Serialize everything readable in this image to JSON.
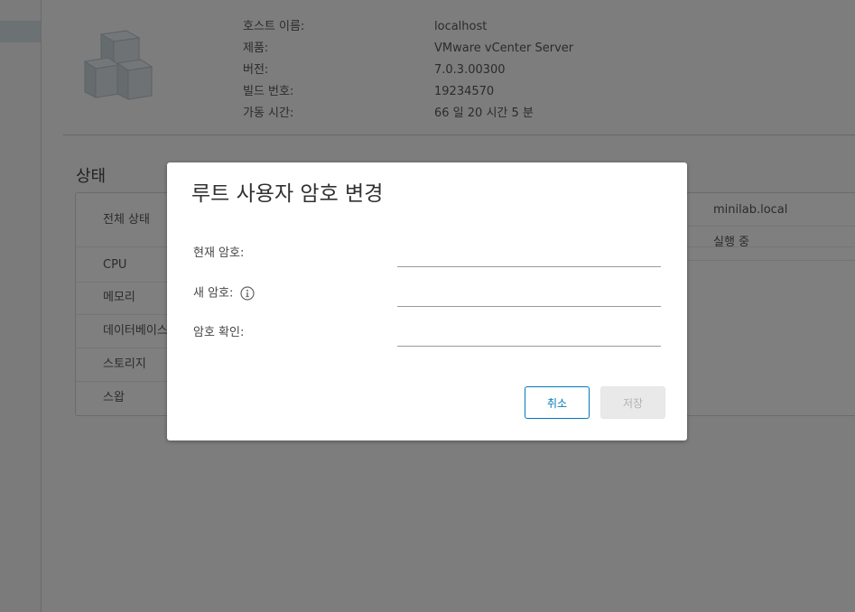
{
  "summary": {
    "labels": [
      "호스트 이름:",
      "제품:",
      "버전:",
      "빌드 번호:",
      "가동 시간:"
    ],
    "values": [
      "localhost",
      "VMware vCenter Server",
      "7.0.3.00300",
      "19234570",
      "66 일 20 시간 5 분"
    ]
  },
  "status": {
    "title": "상태",
    "rows": [
      "전체 상태",
      "CPU",
      "메모리",
      "데이터베이스",
      "스토리지",
      "스왑"
    ],
    "right_values": [
      "minilab.local",
      "실행 중"
    ]
  },
  "dialog": {
    "title": "루트 사용자 암호 변경",
    "current_password_label": "현재 암호:",
    "new_password_label": "새 암호:",
    "confirm_password_label": "암호 확인:",
    "cancel_label": "취소",
    "save_label": "저장"
  },
  "icons": {
    "appliance": "cube-stack-icon",
    "info": "info-circle-icon"
  },
  "colors": {
    "accent": "#0079b8",
    "overlay": "rgba(0,0,0,0.5)",
    "disabled_button": "#e9e9e9"
  }
}
